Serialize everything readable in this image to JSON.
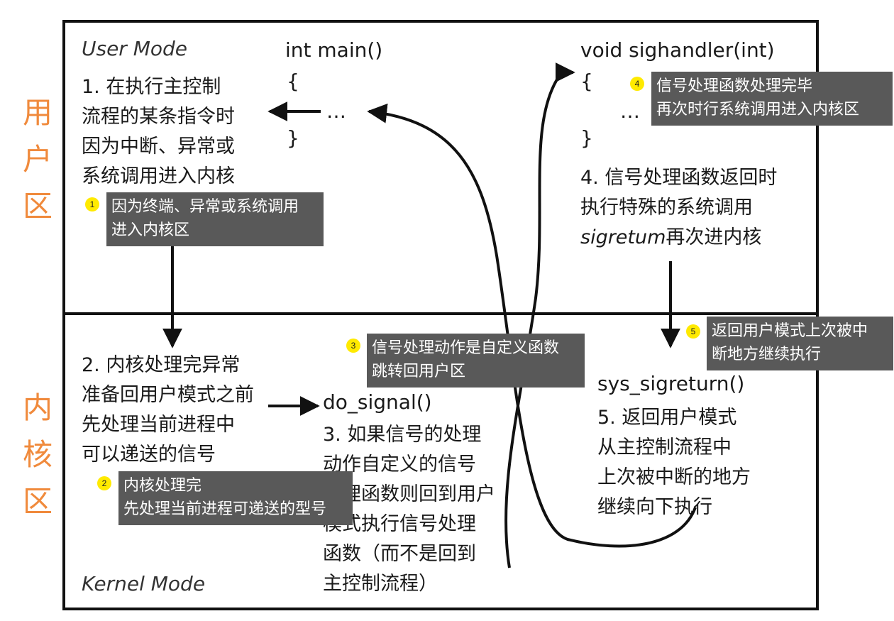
{
  "zones": {
    "user": [
      "用",
      "户",
      "区"
    ],
    "kernel": [
      "内",
      "核",
      "区"
    ]
  },
  "modes": {
    "user": "User Mode",
    "kernel": "Kernel Mode"
  },
  "code": {
    "main_sig": "int main()",
    "main_open": "{",
    "main_body": "…",
    "main_close": "}",
    "handler_sig": "void sighandler(int)",
    "handler_open": "{",
    "handler_body": "…",
    "handler_close": "}",
    "do_signal": "do_signal()",
    "sys_sigreturn": "sys_sigreturn()"
  },
  "steps": {
    "step1": [
      "1. 在执行主控制",
      "流程的某条指令时",
      "因为中断、异常或",
      "系统调用进入内核"
    ],
    "step2": [
      "2. 内核处理完异常",
      "准备回用户模式之前",
      "先处理当前进程中",
      "可以递送的信号"
    ],
    "step3": [
      "3. 如果信号的处理",
      "动作自定义的信号",
      "处理函数则回到用户",
      "模式执行信号处理",
      "函数（而不是回到",
      "主控制流程）"
    ],
    "step4_l1": "4. 信号处理函数返回时",
    "step4_l2": "执行特殊的系统调用",
    "step4_l3_italic": "sigretum",
    "step4_l3_rest": "再次进内核",
    "step5": [
      "5. 返回用户模式",
      "从主控制流程中",
      "上次被中断的地方",
      "继续向下执行"
    ]
  },
  "annotations": [
    {
      "num": "1",
      "lines": [
        "因为终端、异常或系统调用",
        "进入内核区"
      ]
    },
    {
      "num": "2",
      "lines": [
        "内核处理完",
        "先处理当前进程可递送的型号"
      ]
    },
    {
      "num": "3",
      "lines": [
        "信号处理动作是自定义函数",
        "跳转回用户区"
      ]
    },
    {
      "num": "4",
      "lines": [
        "信号处理函数处理完毕",
        "再次时行系统调用进入内核区"
      ]
    },
    {
      "num": "5",
      "lines": [
        "返回用户模式上次被中",
        "断地方继续执行"
      ]
    }
  ],
  "colors": {
    "zone_label": "#f08a3c",
    "note_bg": "#595959",
    "note_text": "#ffffff",
    "marker": "#ffea00",
    "line": "#111111"
  }
}
